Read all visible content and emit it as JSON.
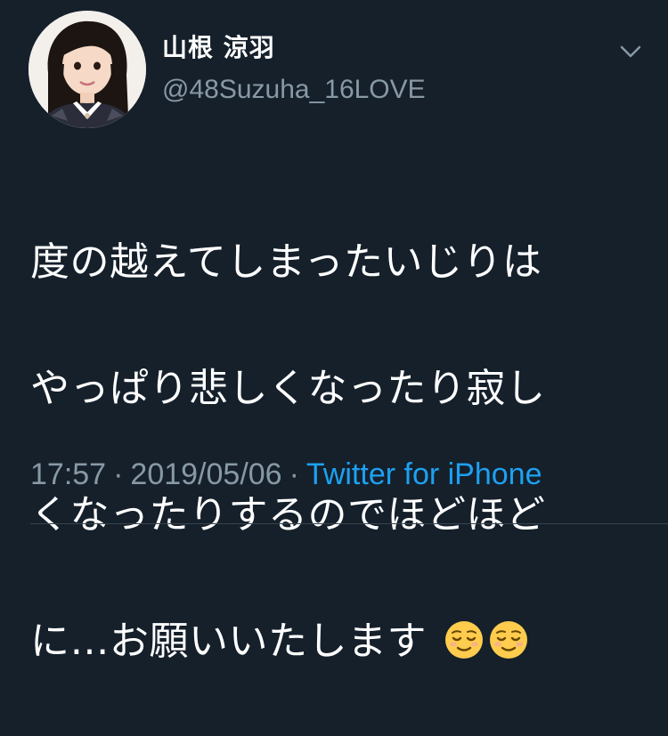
{
  "tweet": {
    "author": {
      "display_name": "山根 涼羽",
      "handle": "@48Suzuha_16LOVE",
      "avatar_icon": "profile-photo"
    },
    "menu_icon": "chevron-down-icon",
    "text_lines": [
      "度の越えてしまったいじりは",
      "やっぱり悲しくなったり寂し",
      "くなったりするのでほどほど",
      "に…お願いいたします"
    ],
    "emojis": [
      "relieved-face",
      "relieved-face"
    ],
    "time": "17:57",
    "separator": "·",
    "date": "2019/05/06",
    "source": "Twitter for iPhone"
  },
  "colors": {
    "background": "#15202b",
    "text": "#ffffff",
    "secondary_text": "#8899a6",
    "link": "#1da1f2",
    "divider": "#38444d"
  }
}
